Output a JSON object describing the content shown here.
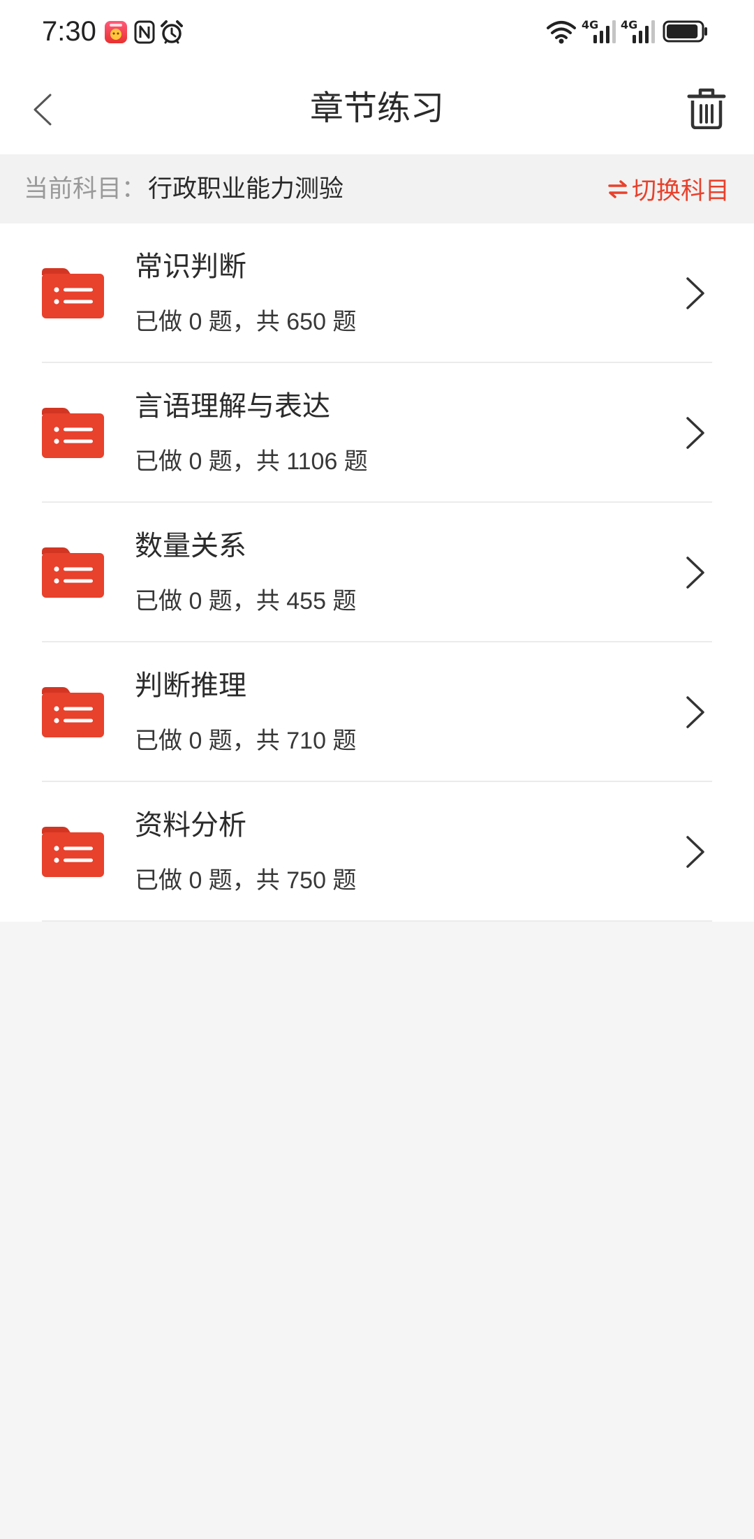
{
  "status_bar": {
    "time": "7:30",
    "network_1": "4G",
    "network_2": "4G",
    "battery_level": 0.92,
    "icons": [
      "app-notification-icon",
      "nfc-icon",
      "alarm-icon",
      "wifi-icon",
      "signal-icon",
      "signal-icon",
      "battery-icon"
    ]
  },
  "header": {
    "title": "章节练习",
    "back_icon": "chevron-left-icon",
    "delete_icon": "trash-icon"
  },
  "subject_bar": {
    "label": "当前科目：",
    "value": "行政职业能力测验",
    "switch_icon": "swap-arrows-icon",
    "switch_label": "切换科目"
  },
  "chapters": [
    {
      "title": "常识判断",
      "progress": "已做 0 题，共 650 题",
      "icon": "folder-list-icon"
    },
    {
      "title": "言语理解与表达",
      "progress": "已做 0 题，共 1106 题",
      "icon": "folder-list-icon"
    },
    {
      "title": "数量关系",
      "progress": "已做 0 题，共 455 题",
      "icon": "folder-list-icon"
    },
    {
      "title": "判断推理",
      "progress": "已做 0 题，共 710 题",
      "icon": "folder-list-icon"
    },
    {
      "title": "资料分析",
      "progress": "已做 0 题，共 750 题",
      "icon": "folder-list-icon"
    }
  ],
  "colors": {
    "accent": "#e8412c",
    "text": "#2b2b2b",
    "muted": "#999999",
    "page_background": "#f5f5f5",
    "subject_bar_background": "#f2f2f2"
  }
}
